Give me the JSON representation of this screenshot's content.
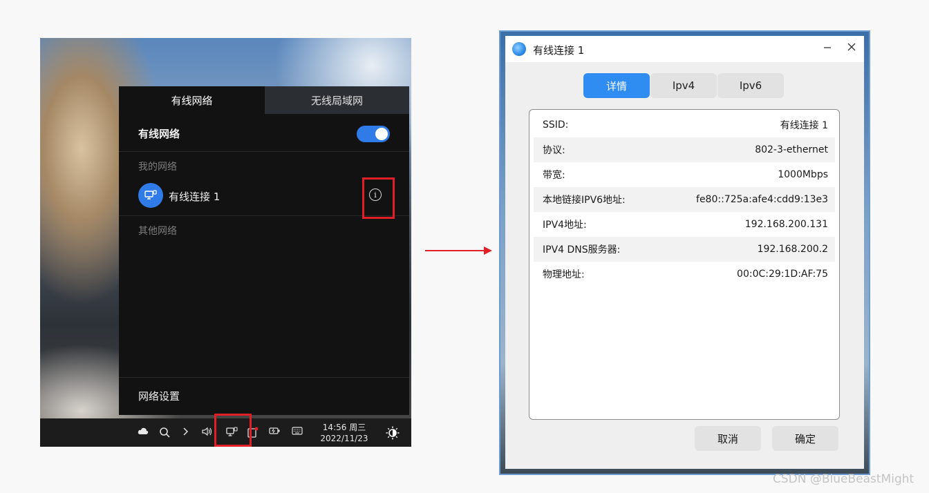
{
  "network_panel": {
    "tabs": [
      "有线网络",
      "无线局域网"
    ],
    "wired_label": "有线网络",
    "wired_enabled": true,
    "my_networks_label": "我的网络",
    "connection_name": "有线连接 1",
    "other_networks_label": "其他网络",
    "settings_label": "网络设置",
    "info_glyph": "i"
  },
  "taskbar": {
    "time": "14:56 周三",
    "date": "2022/11/23",
    "icons": [
      "cloud-icon",
      "search-icon",
      "chevron-right-icon",
      "volume-icon",
      "wired-network-icon",
      "notification-icon",
      "battery-icon",
      "keyboard-icon",
      "theme-icon"
    ]
  },
  "dialog": {
    "title": "有线连接 1",
    "tabs": [
      "详情",
      "Ipv4",
      "Ipv6"
    ],
    "active_tab": "详情",
    "rows": [
      {
        "key": "SSID:",
        "value": "有线连接 1"
      },
      {
        "key": "协议:",
        "value": "802-3-ethernet"
      },
      {
        "key": "带宽:",
        "value": "1000Mbps"
      },
      {
        "key": "本地链接IPV6地址:",
        "value": "fe80::725a:afe4:cdd9:13e3"
      },
      {
        "key": "IPV4地址:",
        "value": "192.168.200.131"
      },
      {
        "key": "IPV4 DNS服务器:",
        "value": "192.168.200.2"
      },
      {
        "key": "物理地址:",
        "value": "00:0C:29:1D:AF:75"
      }
    ],
    "cancel_label": "取消",
    "ok_label": "确定"
  },
  "watermark": "CSDN @BlueBeastMight",
  "colors": {
    "accent": "#2f8cf0",
    "highlight_box": "#e01f26"
  }
}
